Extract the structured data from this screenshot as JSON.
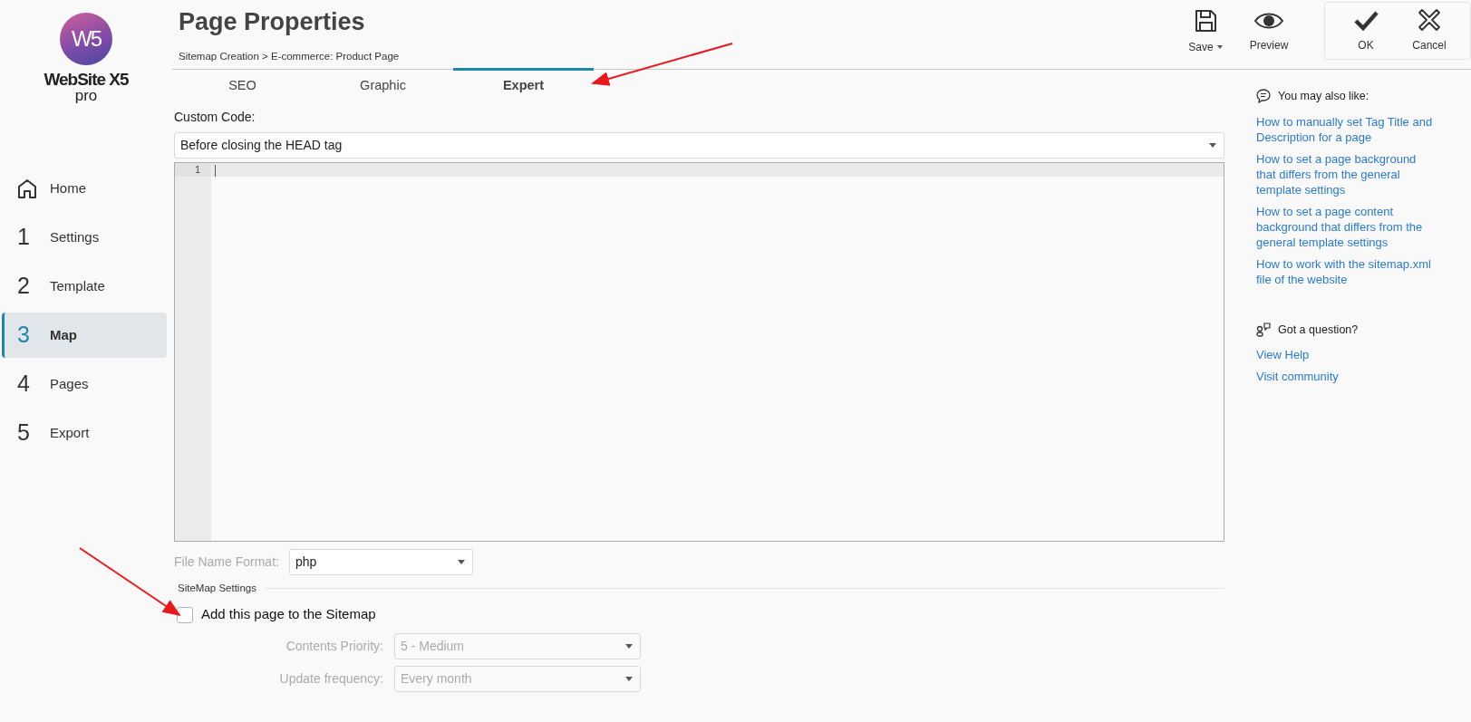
{
  "logo": {
    "mark": "W5",
    "name": "WebSite X5",
    "edition": "pro"
  },
  "nav": [
    {
      "kind": "home",
      "label": "Home",
      "selected": false
    },
    {
      "kind": "step",
      "number": "1",
      "label": "Settings",
      "selected": false
    },
    {
      "kind": "step",
      "number": "2",
      "label": "Template",
      "selected": false
    },
    {
      "kind": "step",
      "number": "3",
      "label": "Map",
      "selected": true
    },
    {
      "kind": "step",
      "number": "4",
      "label": "Pages",
      "selected": false
    },
    {
      "kind": "step",
      "number": "5",
      "label": "Export",
      "selected": false
    }
  ],
  "header": {
    "title": "Page Properties",
    "breadcrumb": "Sitemap Creation > E-commerce: Product Page"
  },
  "toolbar": [
    {
      "kind": "save",
      "label": "Save",
      "dropdown": true
    },
    {
      "kind": "preview",
      "label": "Preview",
      "dropdown": false
    }
  ],
  "dialog_buttons": [
    {
      "kind": "ok",
      "label": "OK"
    },
    {
      "kind": "cancel",
      "label": "Cancel"
    }
  ],
  "tabs": [
    {
      "label": "SEO",
      "selected": false
    },
    {
      "label": "Graphic",
      "selected": false
    },
    {
      "label": "Expert",
      "selected": true
    }
  ],
  "custom_code": {
    "label": "Custom Code:",
    "position": "Before closing the HEAD tag",
    "line_numbers": [
      "1"
    ]
  },
  "file_name_format": {
    "label": "File Name Format:",
    "value": "php"
  },
  "sitemap": {
    "heading": "SiteMap Settings",
    "checkbox": {
      "label": "Add this page to the Sitemap",
      "checked": false
    },
    "fields": [
      {
        "label": "Contents Priority:",
        "value": "5 - Medium",
        "disabled": true
      },
      {
        "label": "Update frequency:",
        "value": "Every month",
        "disabled": true
      }
    ]
  },
  "help_panel": {
    "heading": "You may also like:",
    "links": [
      "How to manually set Tag Title and Description for a page",
      "How to set a page background that differs from the general template settings",
      "How to set a page content background that differs from the general template settings",
      "How to work with the sitemap.xml file of the website"
    ],
    "question_heading": "Got a question?",
    "question_links": [
      "View Help",
      "Visit community"
    ]
  }
}
